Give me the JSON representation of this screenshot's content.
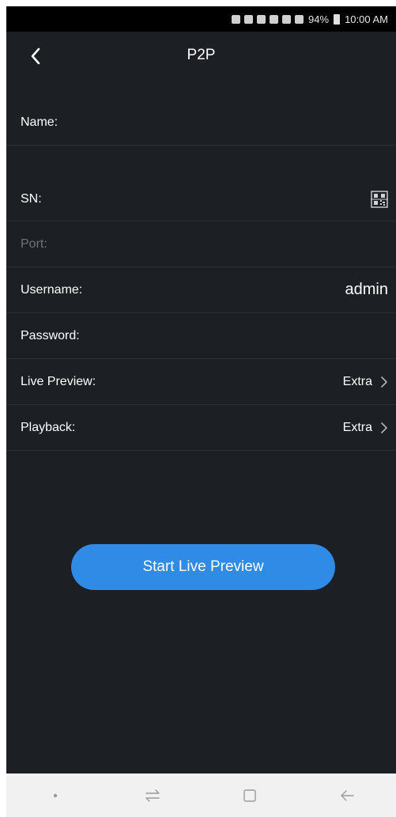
{
  "status_bar": {
    "battery_percent": "94%",
    "time": "10:00 AM",
    "icons": [
      "bluetooth-icon",
      "nfc-icon",
      "mute-icon",
      "alarm-icon",
      "wifi-icon",
      "signal-icon",
      "battery-icon"
    ]
  },
  "header": {
    "title": "P2P",
    "back_icon": "chevron-left-icon"
  },
  "form": {
    "name_label": "Name:",
    "sn_label": "SN:",
    "sn_icon": "qr-code-icon",
    "port_label": "Port:",
    "username_label": "Username:",
    "username_value": "admin",
    "password_label": "Password:",
    "live_preview_label": "Live Preview:",
    "live_preview_value": "Extra",
    "playback_label": "Playback:",
    "playback_value": "Extra"
  },
  "actions": {
    "start_live_preview": "Start Live Preview"
  },
  "navbar": {
    "icons": [
      "dot-icon",
      "recent-apps-icon",
      "home-icon",
      "back-arrow-icon"
    ]
  },
  "colors": {
    "background": "#1c1f24",
    "accent": "#2f8be6",
    "text": "#ffffff",
    "muted": "#6e737b",
    "navbar": "#f1f1f1"
  }
}
